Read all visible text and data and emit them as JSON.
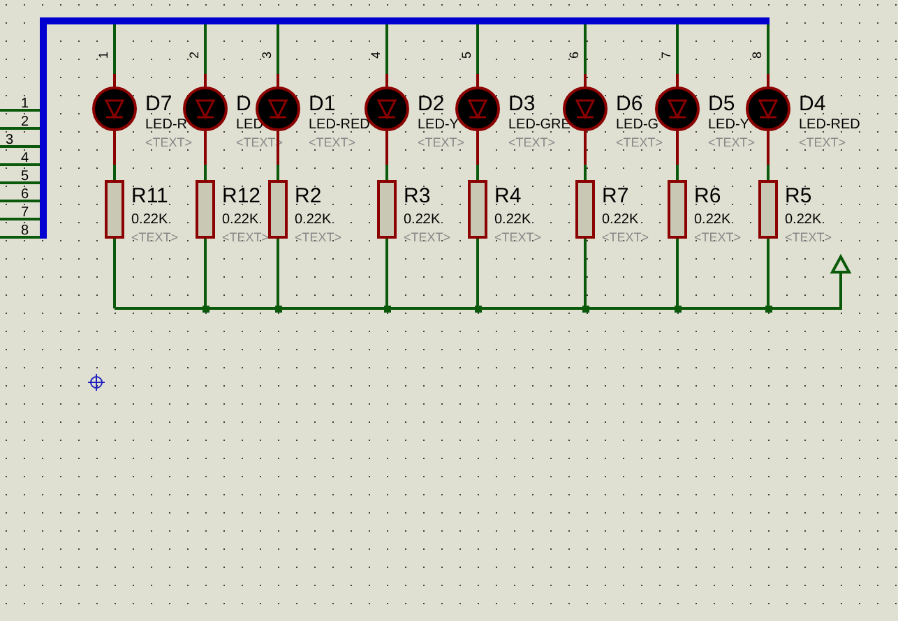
{
  "connector": {
    "pins": [
      "1",
      "2",
      "3",
      "4",
      "5",
      "6",
      "7",
      "8"
    ]
  },
  "columns": [
    {
      "pin": "1",
      "led": {
        "name": "D7",
        "label": "LED-R",
        "text": "<TEXT>"
      },
      "resistor": {
        "name": "R11",
        "value": "0.22K",
        "text": "<TEXT>"
      }
    },
    {
      "pin": "2",
      "led": {
        "name": "D",
        "label": "LED",
        "text": "<TEXT>"
      },
      "resistor": {
        "name": "R12",
        "value": "0.22K",
        "text": "<TEXT>"
      }
    },
    {
      "pin": "3",
      "led": {
        "name": "D1",
        "label": "LED-RED",
        "text": "<TEXT>"
      },
      "resistor": {
        "name": "R2",
        "value": "0.22K",
        "text": "<TEXT>"
      }
    },
    {
      "pin": "4",
      "led": {
        "name": "D2",
        "label": "LED-Y",
        "text": "<TEXT>"
      },
      "resistor": {
        "name": "R3",
        "value": "0.22K",
        "text": "<TEXT>"
      }
    },
    {
      "pin": "5",
      "led": {
        "name": "D3",
        "label": "LED-GRE",
        "text": "<TEXT>"
      },
      "resistor": {
        "name": "R4",
        "value": "0.22K",
        "text": "<TEXT>"
      }
    },
    {
      "pin": "6",
      "led": {
        "name": "D6",
        "label": "LED-G",
        "text": "<TEXT>"
      },
      "resistor": {
        "name": "R7",
        "value": "0.22K",
        "text": "<TEXT>"
      }
    },
    {
      "pin": "7",
      "led": {
        "name": "D5",
        "label": "LED-Y",
        "text": "<TEXT>"
      },
      "resistor": {
        "name": "R6",
        "value": "0.22K",
        "text": "<TEXT>"
      }
    },
    {
      "pin": "8",
      "led": {
        "name": "D4",
        "label": "LED-RED",
        "text": "<TEXT>"
      },
      "resistor": {
        "name": "R5",
        "value": "0.22K",
        "text": "<TEXT>"
      }
    }
  ]
}
